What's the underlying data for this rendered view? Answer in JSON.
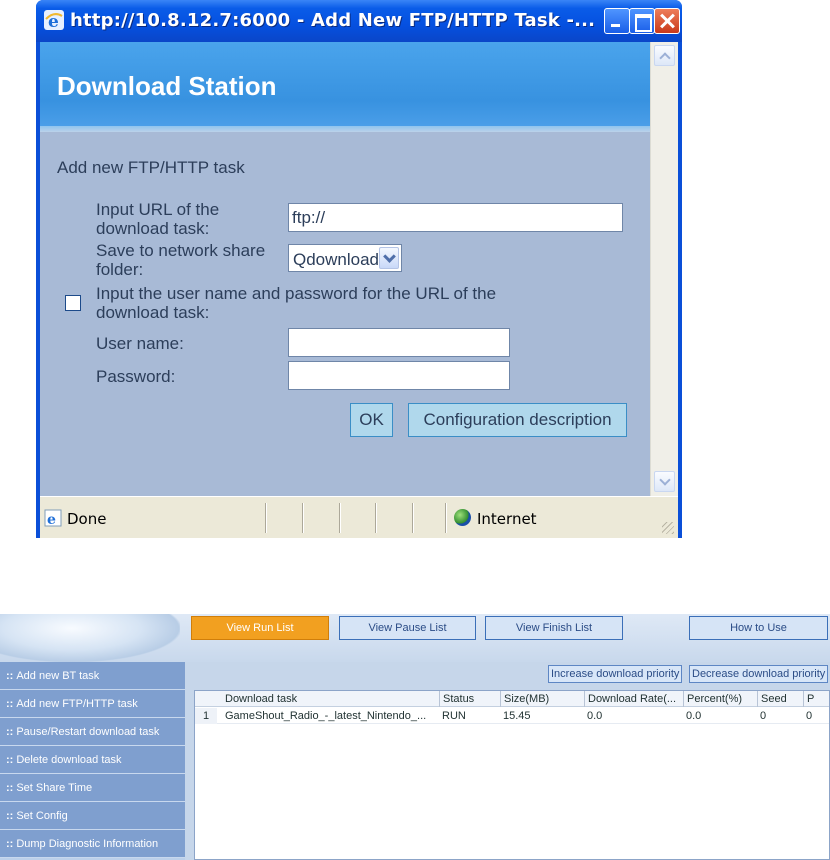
{
  "popup": {
    "title": "http://10.8.12.7:6000 - Add New FTP/HTTP Task -...",
    "banner_title": "Download Station",
    "form": {
      "heading": "Add new FTP/HTTP task",
      "url_label_line1": "Input URL of the",
      "url_label_line2": "download task:",
      "url_value": "ftp://",
      "share_label_line1": "Save to network share",
      "share_label_line2": "folder:",
      "share_selected": "Qdownload",
      "auth_label_line1": "Input the user name and password for the URL of the",
      "auth_label_line2": "download task:",
      "auth_checked": false,
      "username_label": "User name:",
      "username_value": "",
      "password_label": "Password:",
      "password_value": "",
      "ok_label": "OK",
      "config_label": "Configuration description"
    },
    "status": {
      "text": "Done",
      "zone": "Internet"
    }
  },
  "app": {
    "nav": {
      "run": "View Run List",
      "pause": "View Pause List",
      "finish": "View Finish List",
      "howto": "How to Use"
    },
    "sidebar": [
      "Add new BT task",
      "Add new FTP/HTTP task",
      "Pause/Restart download task",
      "Delete download task",
      "Set Share Time",
      "Set Config",
      "Dump Diagnostic Information"
    ],
    "priority": {
      "increase": "Increase download priority",
      "decrease": "Decrease download priority"
    },
    "grid": {
      "headers": [
        "Download task",
        "Status",
        "Size(MB)",
        "Download Rate(...",
        "Percent(%)",
        "Seed",
        "P"
      ],
      "rows": [
        {
          "num": "1",
          "cells": [
            "GameShout_Radio_-_latest_Nintendo_...",
            "RUN",
            "15.45",
            "0.0",
            "0.0",
            "0",
            "0"
          ]
        }
      ]
    }
  }
}
